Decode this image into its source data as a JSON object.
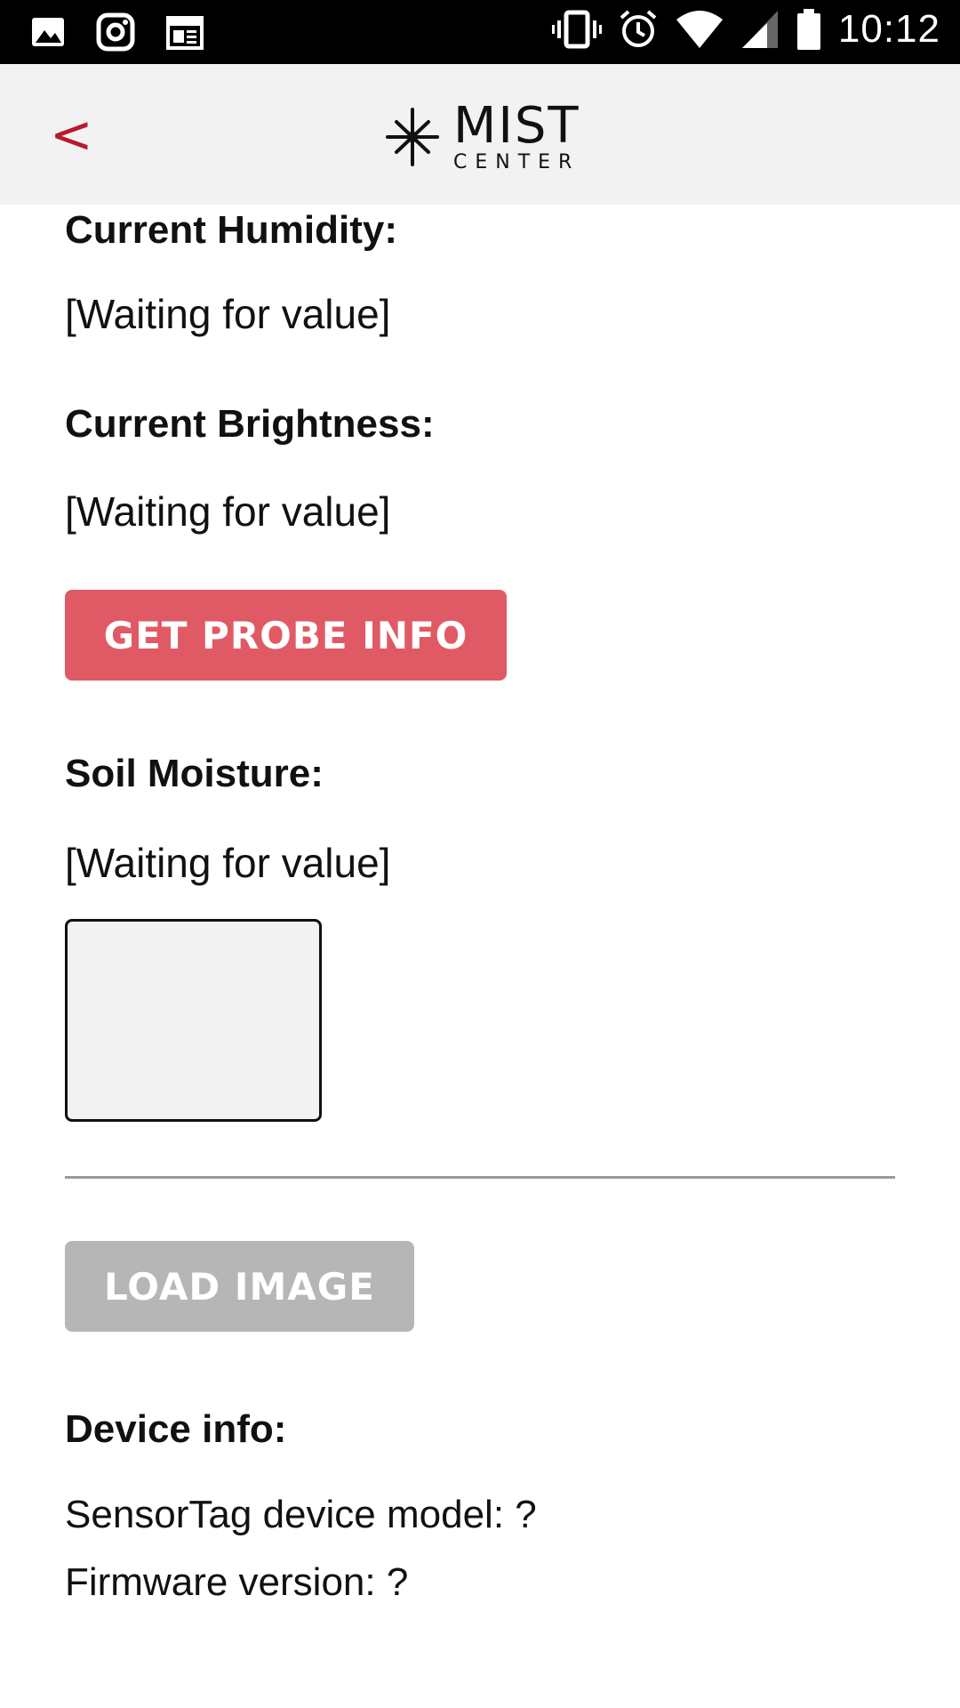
{
  "status_bar": {
    "time": "10:12",
    "left_icons": [
      "image-icon",
      "instagram-icon",
      "calendar-icon"
    ],
    "right_icons": [
      "vibrate-icon",
      "alarm-icon",
      "wifi-icon",
      "cell-signal-icon",
      "battery-icon"
    ]
  },
  "header": {
    "back_label": "<",
    "logo_main": "MIST",
    "logo_sub": "CENTER"
  },
  "sensors": {
    "humidity_label": "Current Humidity:",
    "humidity_value": "[Waiting for value]",
    "brightness_label": "Current Brightness:",
    "brightness_value": "[Waiting for value]",
    "probe_button": "GET PROBE INFO",
    "soil_label": "Soil Moisture:",
    "soil_value": "[Waiting for value]"
  },
  "image": {
    "load_button": "LOAD IMAGE"
  },
  "device": {
    "title": "Device info:",
    "model": "SensorTag device model: ?",
    "firmware": "Firmware version: ?"
  },
  "colors": {
    "accent_red": "#e05a66",
    "back_red": "#b8192e",
    "disabled_gray": "#b6b6b6",
    "header_bg": "#f2f2f2"
  }
}
